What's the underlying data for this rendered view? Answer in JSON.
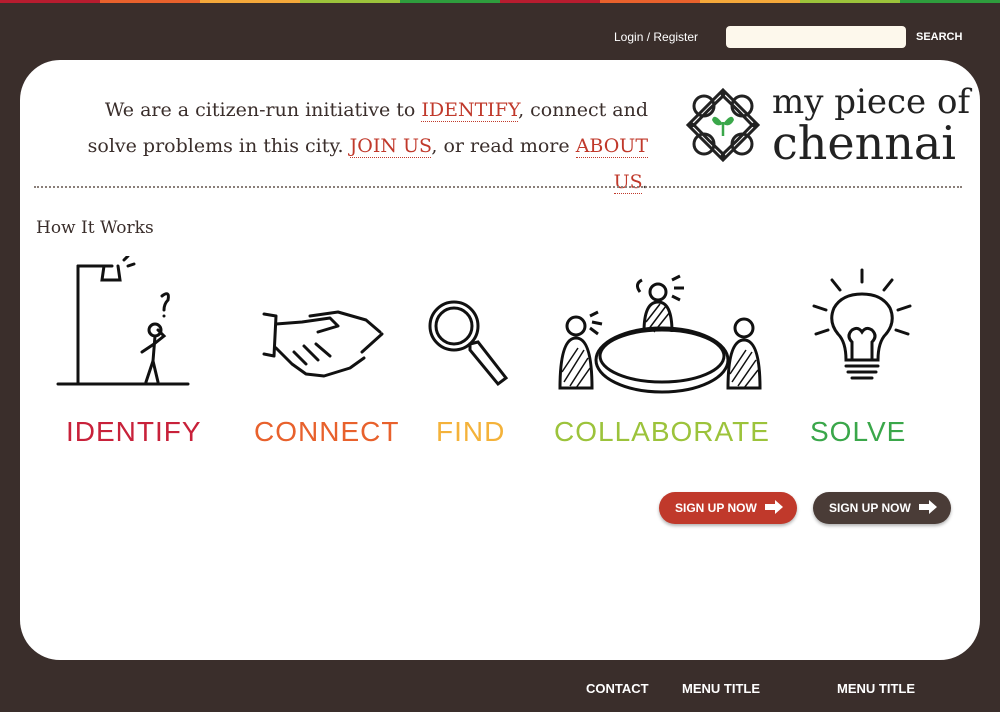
{
  "colors": {
    "stripe": [
      "#b71c2f",
      "#e8612c",
      "#f4a83a",
      "#9cc33b",
      "#2e9d3d",
      "#b71c2f",
      "#e8612c",
      "#f4a83a",
      "#9cc33b",
      "#2e9d3d"
    ],
    "background": "#3a2e2b",
    "accent_red": "#c0392b",
    "button_dark": "#4a3c37"
  },
  "header": {
    "login_label": "Login / Register",
    "search_placeholder": "",
    "search_label": "SEARCH"
  },
  "intro": {
    "part1": "We are a citizen-run initiative to ",
    "identify_link": "IDENTIFY",
    "part2": ", connect and solve problems in this city. ",
    "join_link": "JOIN US",
    "part3": ", or read more ",
    "about_link": "ABOUT US",
    "part4": "."
  },
  "logo": {
    "line1": "my piece of",
    "line2": "chennai"
  },
  "how_it_works": {
    "title": "How It Works",
    "steps": [
      {
        "label": "IDENTIFY",
        "icon": "stick-figure-streetlamp-icon",
        "color": "#c8213a"
      },
      {
        "label": "CONNECT",
        "icon": "handshake-icon",
        "color": "#e8612c"
      },
      {
        "label": "FIND",
        "icon": "magnifying-glass-icon",
        "color": "#f4b23a"
      },
      {
        "label": "COLLABORATE",
        "icon": "meeting-table-icon",
        "color": "#9cc33b"
      },
      {
        "label": "SOLVE",
        "icon": "light-bulb-icon",
        "color": "#3aa74a"
      }
    ]
  },
  "buttons": {
    "signup_red": "SIGN UP NOW",
    "signup_dark": "SIGN UP NOW"
  },
  "footer": {
    "contact": "CONTACT",
    "menu1": "MENU TITLE",
    "menu2": "MENU TITLE"
  }
}
